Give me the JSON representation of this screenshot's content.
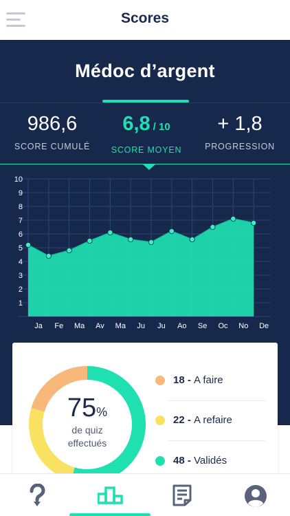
{
  "header": {
    "title": "Scores",
    "menu_icon": "hamburger-menu-icon"
  },
  "hero": {
    "title": "Médoc d’argent",
    "stats": [
      {
        "value": "986,6",
        "label": "SCORE CUMULÉ"
      },
      {
        "value": "6,8",
        "suffix": "/ 10",
        "label": "SCORE MOYEN"
      },
      {
        "value": "+ 1,8",
        "label": "PROGRESSION"
      }
    ]
  },
  "chart_data": {
    "type": "area",
    "categories": [
      "Ja",
      "Fe",
      "Ma",
      "Av",
      "Ma",
      "Ju",
      "Ju",
      "Ao",
      "Se",
      "Oc",
      "No",
      "De"
    ],
    "values": [
      5.2,
      4.4,
      4.8,
      5.5,
      6.1,
      5.6,
      5.4,
      6.2,
      5.6,
      6.5,
      7.1,
      6.8,
      null
    ],
    "y_ticks": [
      "1",
      "2",
      "3",
      "4",
      "5",
      "6",
      "7",
      "8",
      "9",
      "10"
    ],
    "ylim": [
      0,
      10
    ],
    "grid": true,
    "colors": {
      "fill": "#1fe0b0",
      "point": "#1fe0b0",
      "grid": "#2b4673",
      "label": "#ffffff",
      "muted_label": "#5d6c8c"
    }
  },
  "quiz_summary": {
    "percent": "75",
    "percent_sign": "%",
    "caption_line1": "de quiz",
    "caption_line2": "effectués",
    "segments": [
      {
        "count": "18",
        "label": "A faire",
        "color": "#f8b87a",
        "value": 18
      },
      {
        "count": "22",
        "label": "A refaire",
        "color": "#f9e262",
        "value": 22
      },
      {
        "count": "48",
        "label": "Validés",
        "color": "#1fe0b0",
        "value": 48
      }
    ]
  },
  "bottom_nav": {
    "items": [
      {
        "icon": "question-mark-icon"
      },
      {
        "icon": "podium-icon",
        "active": true
      },
      {
        "icon": "document-icon"
      },
      {
        "icon": "user-profile-icon"
      }
    ],
    "active_color": "#1fe0b0"
  }
}
